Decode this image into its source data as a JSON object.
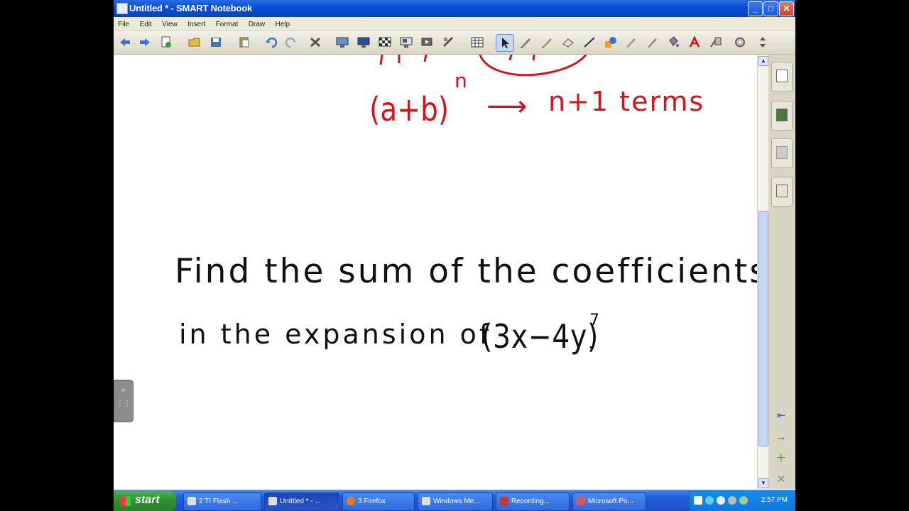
{
  "window": {
    "title": "Untitled * - SMART Notebook"
  },
  "menu": [
    "File",
    "Edit",
    "View",
    "Insert",
    "Format",
    "Draw",
    "Help"
  ],
  "toolbar": {
    "icons": [
      "back-icon",
      "forward-icon",
      "add-page-icon",
      "open-icon",
      "save-icon",
      "paste-icon",
      "undo-icon",
      "redo-icon",
      "delete-icon",
      "screen-shade-icon",
      "full-screen-icon",
      "transparent-background-icon",
      "capture-icon",
      "video-icon",
      "table-icon",
      "select-icon",
      "pen-icon",
      "creative-pen-icon",
      "eraser-icon",
      "line-icon",
      "shape-icon",
      "magic-pen-icon",
      "fill-icon",
      "text-icon",
      "properties-icon",
      "move-toolbar-icon"
    ]
  },
  "canvas": {
    "red_line1_left": "(a+b)",
    "red_exponent": "n",
    "red_arrow": "⟶",
    "red_result": "n+1 terms",
    "problem_line1": "Find the sum of the coefficients",
    "problem_line2_prefix": "in the expansion of",
    "problem_expr": "(3x−4y)",
    "problem_exponent": "7",
    "problem_period": "."
  },
  "taskbar": {
    "start_label": "start",
    "tasks": [
      "2 TI Flash ...",
      "Untitled * - ...",
      "3 Firefox",
      "Windows Me...",
      "Recording...",
      "Microsoft Po..."
    ],
    "clock": "2:57 PM"
  },
  "colors": {
    "ink_red": "#d8121b",
    "ink_black": "#111111",
    "xp_blue": "#245edb"
  }
}
